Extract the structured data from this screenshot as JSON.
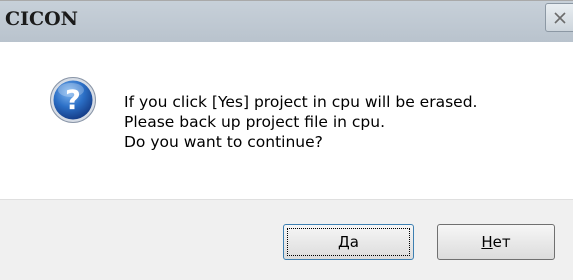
{
  "window": {
    "title": "CICON"
  },
  "message": {
    "line1": "If you click [Yes] project in cpu will be erased.",
    "line2": "Please back up project file in cpu.",
    "line3": "Do you want to continue?"
  },
  "icon": {
    "name": "question-icon",
    "glyph": "?",
    "color": "#1c5fb5"
  },
  "buttons": {
    "yes": {
      "label": "Да",
      "accel": "Д",
      "rest": "а"
    },
    "no": {
      "label": "Нет",
      "accel": "Н",
      "rest": "ет"
    }
  }
}
